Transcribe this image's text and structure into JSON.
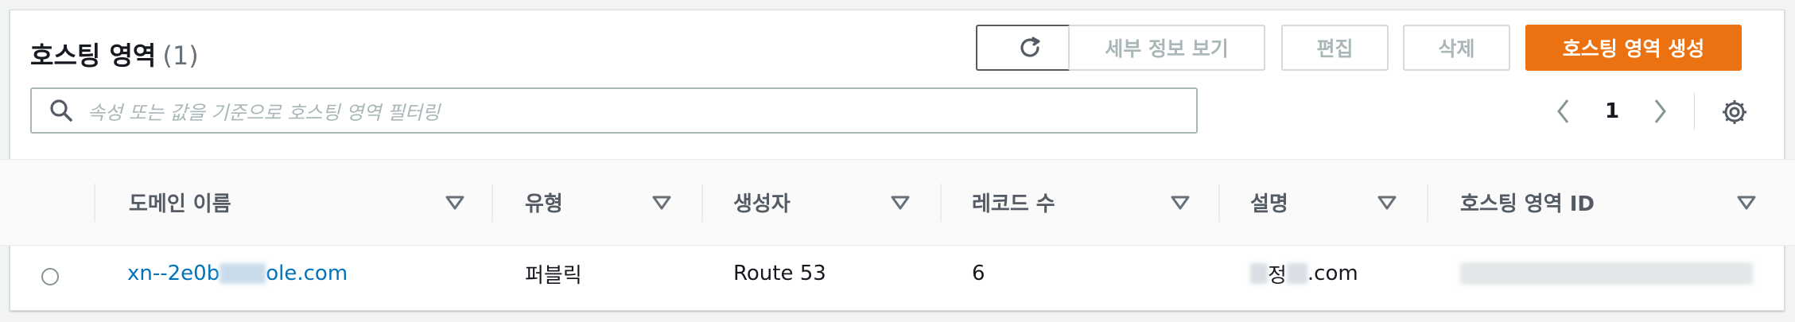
{
  "panel": {
    "title": "호스팅 영역",
    "count": "(1)"
  },
  "actions": {
    "refresh_icon": "refresh-icon",
    "details_label": "세부 정보 보기",
    "edit_label": "편집",
    "delete_label": "삭제",
    "create_label": "호스팅 영역 생성"
  },
  "search": {
    "placeholder": "속성 또는 값을 기준으로 호스팅 영역 필터링",
    "icon": "search-icon"
  },
  "pagination": {
    "current_page": "1",
    "prev_icon": "chevron-left-icon",
    "next_icon": "chevron-right-icon"
  },
  "settings_icon": "gear-icon",
  "table": {
    "columns": [
      {
        "label": "도메인 이름"
      },
      {
        "label": "유형"
      },
      {
        "label": "생성자"
      },
      {
        "label": "레코드 수"
      },
      {
        "label": "설명"
      },
      {
        "label": "호스팅 영역 ID"
      }
    ],
    "rows": [
      {
        "domain_prefix": "xn--2e0b",
        "domain_suffix": "ole.com",
        "type": "퍼블릭",
        "created_by": "Route 53",
        "record_count": "6",
        "description_mid": "정",
        "description_suffix": ".com"
      }
    ]
  },
  "colors": {
    "primary_button": "#ec7211",
    "link": "#0073bb",
    "disabled_text": "#aab7b8"
  }
}
